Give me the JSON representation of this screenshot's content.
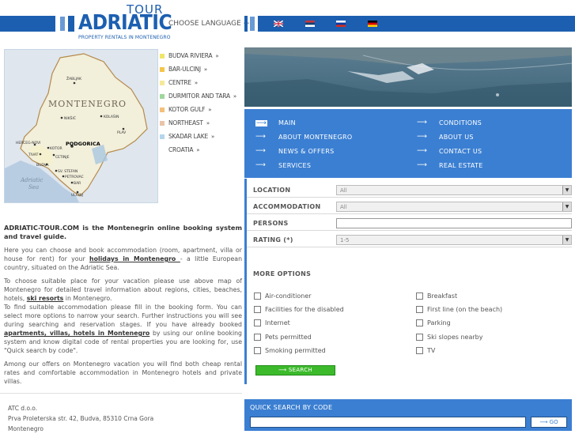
{
  "header": {
    "logo_tour": "TOUR",
    "logo_main": "ADRIATIC",
    "logo_sub": "PROPERTY RENTALS IN MONTENEGRO",
    "choose_language": "CHOOSE LANGUAGE",
    "languages": [
      "English",
      "Serbian",
      "Russian",
      "German"
    ]
  },
  "regions": [
    {
      "label": "BUDVA RIVIERA",
      "color": "#f0e56a"
    },
    {
      "label": "BAR-ULCINJ",
      "color": "#f3c64a"
    },
    {
      "label": "CENTRE",
      "color": "#f6e899"
    },
    {
      "label": "DURMITOR AND TARA",
      "color": "#9ed79c"
    },
    {
      "label": "KOTOR GULF",
      "color": "#f4c07a"
    },
    {
      "label": "NORTHEAST",
      "color": "#e9c4a8"
    },
    {
      "label": "SKADAR LAKE",
      "color": "#b4d6ec"
    },
    {
      "label": "CROATIA",
      "color": ""
    }
  ],
  "map": {
    "country": "MONTENEGRO",
    "sea": "Adriatic Sea",
    "cities": [
      "ŽABLJAK",
      "NIKŠIĆ",
      "KOLAŠIN",
      "PLAV",
      "HERCEG-NOVI",
      "KOTOR",
      "PODGORICA",
      "CETINJE",
      "TIVAT",
      "BUDVA",
      "SV. STEFAN",
      "PETROVAC",
      "BAR",
      "ULCINJ"
    ]
  },
  "nav": {
    "left": [
      "MAIN",
      "ABOUT MONTENEGRO",
      "NEWS & OFFERS",
      "SERVICES"
    ],
    "right": [
      "CONDITIONS",
      "ABOUT US",
      "CONTACT US",
      "REAL ESTATE"
    ]
  },
  "form": {
    "location_label": "LOCATION",
    "location_value": "All",
    "accommodation_label": "ACCOMMODATION",
    "accommodation_value": "All",
    "persons_label": "PERSONS",
    "rating_label": "RATING (*)",
    "rating_value": "1-5",
    "more_options": "MORE OPTIONS",
    "options_left": [
      "Air-conditioner",
      "Facilities for the disabled",
      "Internet",
      "Pets permitted",
      "Smoking permitted"
    ],
    "options_right": [
      "Breakfast",
      "First line (on the beach)",
      "Parking",
      "Ski slopes nearby",
      "TV"
    ],
    "search_label": "SEARCH"
  },
  "quick": {
    "title": "QUICK SEARCH BY CODE",
    "go_label": "GO"
  },
  "intro": {
    "heading": "ADRIATIC-TOUR.COM is the Montenegrin online booking system and travel guide.",
    "p2_a": "Here you can choose and book accommodation (room, apartment, villa or house for rent) for your ",
    "p2_link": "holidays in Montenegro ",
    "p2_b": "- a little European country, situated on the Adriatic Sea.",
    "p3_a": "To choose suitable place for your vacation please use above map of Montenegro for detailed travel information about regions, cities, beaches, hotels, ",
    "p3_link": "ski resorts",
    "p3_b": " in Montenegro.",
    "p3_c": "To find suitable accommodation please fill in the booking form. You can select more options to narrow your search. Further instructions you will see during searching and reservation stages. If you have already booked ",
    "p3_link2": "apartments, villas, hotels in Montenegro",
    "p3_d": " by using our online booking system and know digital code of rental properties you are looking for, use \"Quick search by code\".",
    "p4": "Among our offers on Montenegro vacation you will find both cheap rental rates and comfortable accommodation in Montenegro hotels and private villas."
  },
  "footer": {
    "company": "ATC d.o.o.",
    "address": "Prva Proleterska str. 42, Budva, 85310 Crna Gora",
    "country": "Montenegro"
  }
}
